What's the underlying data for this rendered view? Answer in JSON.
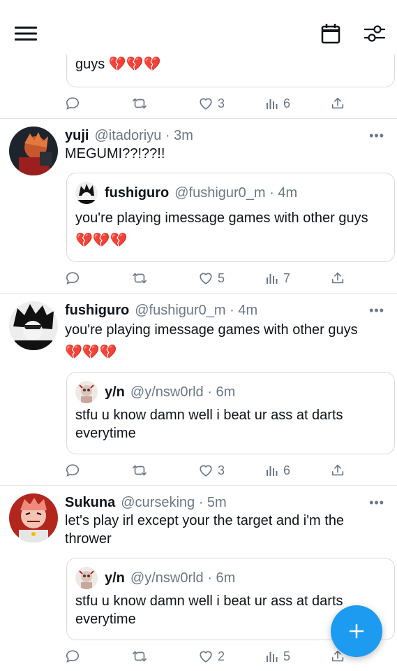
{
  "header": {
    "menu_icon": "hamburger-icon",
    "calendar_icon": "calendar-icon",
    "filter_icon": "sliders-icon"
  },
  "partial_tweet": {
    "quote_tail": "guys 💔💔💔",
    "actions": {
      "replies": "",
      "retweets": "",
      "likes": "3",
      "views": "6"
    }
  },
  "tweets": [
    {
      "name": "yuji",
      "handle": "@itadoriyu · 3m",
      "text": "MEGUMI??!??!!",
      "quote": {
        "name": "fushiguro",
        "handle": "@fushigur0_m · 4m",
        "text": "you're playing imessage games with other guys 💔💔💔"
      },
      "actions": {
        "replies": "",
        "retweets": "",
        "likes": "5",
        "views": "7"
      }
    },
    {
      "name": "fushiguro",
      "handle": "@fushigur0_m · 4m",
      "text": "you're playing imessage games with other guys 💔💔💔",
      "quote": {
        "name": "y/n",
        "handle": "@y/nsw0rld · 6m",
        "text": "stfu u know damn well i beat ur ass at darts everytime"
      },
      "actions": {
        "replies": "",
        "retweets": "",
        "likes": "3",
        "views": "6"
      }
    },
    {
      "name": "Sukuna",
      "handle": "@curseking · 5m",
      "text": "let's play irl except your the target and i'm the thrower",
      "quote": {
        "name": "y/n",
        "handle": "@y/nsw0rld · 6m",
        "text": "stfu u know damn well i beat ur ass at darts everytime"
      },
      "actions": {
        "replies": "",
        "retweets": "",
        "likes": "2",
        "views": "5"
      }
    }
  ],
  "more_label": "•••",
  "fab_icon": "plus-icon",
  "colors": {
    "accent": "#1d9bf0",
    "muted": "#6b7784",
    "heart": "#d93a57"
  }
}
